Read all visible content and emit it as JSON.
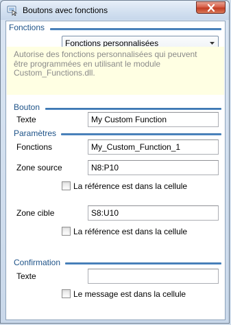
{
  "window": {
    "title": "Boutons avec fonctions",
    "icon": "button-app-icon",
    "close_icon": "close-icon"
  },
  "fonctions": {
    "section_title": "Fonctions",
    "select_value": "Fonctions personnalisées",
    "description_lines": [
      "Autorise des fonctions personnalisées qui peuvent",
      "être programmées en utilisant le module",
      "Custom_Functions.dll."
    ]
  },
  "bouton": {
    "section_title": "Bouton",
    "texte_label": "Texte",
    "texte_value": "My Custom Function"
  },
  "parametres": {
    "section_title": "Paramètres",
    "fonctions_label": "Fonctions",
    "fonctions_value": "My_Custom_Function_1",
    "zone_source_label": "Zone source",
    "zone_source_value": "N8:P10",
    "source_ref_checkbox_label": "La référence est dans la cellule",
    "source_ref_checked": false,
    "zone_cible_label": "Zone cible",
    "zone_cible_value": "S8:U10",
    "cible_ref_checkbox_label": "La référence est dans la cellule",
    "cible_ref_checked": false
  },
  "confirmation": {
    "section_title": "Confirmation",
    "texte_label": "Texte",
    "texte_value": "",
    "message_checkbox_label": "Le message est dans la cellule",
    "message_checked": false
  }
}
